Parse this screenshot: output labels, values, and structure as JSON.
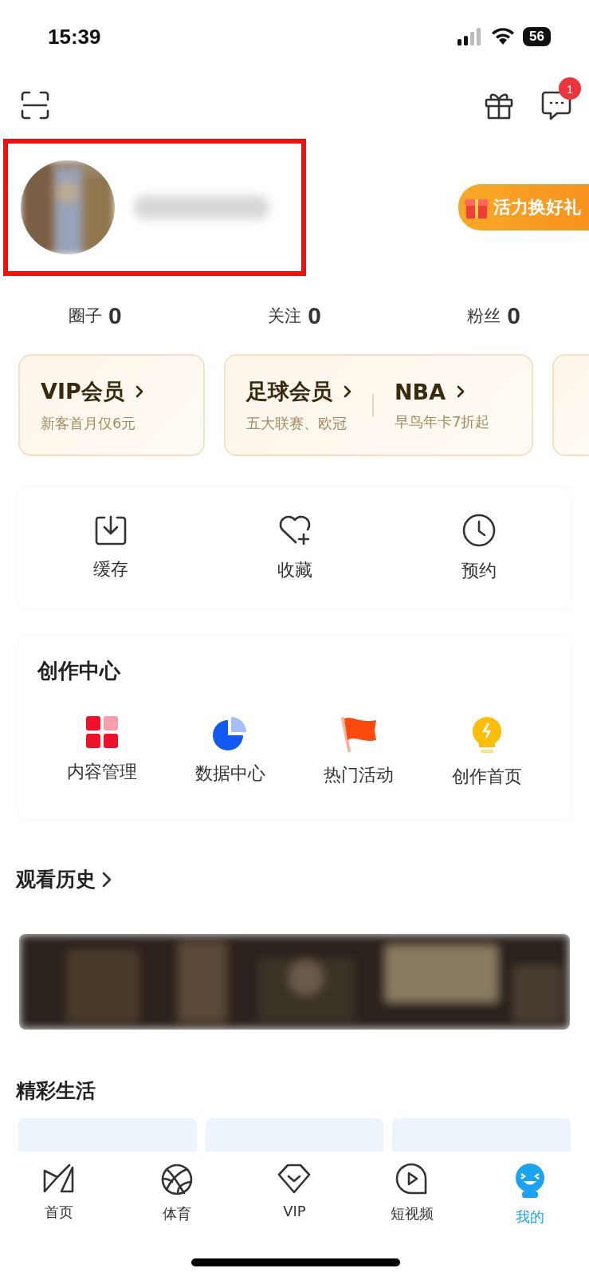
{
  "status_bar": {
    "time": "15:39",
    "battery": "56"
  },
  "header": {
    "message_badge": "1"
  },
  "profile": {
    "name_blurred": true,
    "annotated": true,
    "promo": "活力换好礼"
  },
  "stats": [
    {
      "label": "圈子",
      "value": "0"
    },
    {
      "label": "关注",
      "value": "0"
    },
    {
      "label": "粉丝",
      "value": "0"
    }
  ],
  "member_cards": [
    {
      "items": [
        {
          "title": "VIP会员",
          "subtitle": "新客首月仅6元"
        }
      ]
    },
    {
      "items": [
        {
          "title": "足球会员",
          "subtitle": "五大联赛、欧冠"
        },
        {
          "title": "NBA",
          "subtitle": "早鸟年卡7折起"
        }
      ]
    }
  ],
  "quick_actions": [
    {
      "kind": "download",
      "label": "缓存"
    },
    {
      "kind": "favorite",
      "label": "收藏"
    },
    {
      "kind": "clock",
      "label": "预约"
    }
  ],
  "creation_center": {
    "title": "创作中心",
    "items": [
      {
        "kind": "grid",
        "label": "内容管理"
      },
      {
        "kind": "pie",
        "label": "数据中心"
      },
      {
        "kind": "flag",
        "label": "热门活动"
      },
      {
        "kind": "bulb",
        "label": "创作首页"
      }
    ]
  },
  "history": {
    "title": "观看历史"
  },
  "life": {
    "title": "精彩生活",
    "cards": [
      {
        "kind": "card"
      },
      {
        "kind": "card"
      },
      {
        "kind": "card"
      }
    ]
  },
  "tab_bar": [
    {
      "kind": "home",
      "label": "首页",
      "selected": false
    },
    {
      "kind": "ball",
      "label": "体育",
      "selected": false
    },
    {
      "kind": "vip",
      "label": "VIP",
      "selected": false
    },
    {
      "kind": "video",
      "label": "短视频",
      "selected": false
    },
    {
      "kind": "me",
      "label": "我的",
      "selected": true
    }
  ]
}
